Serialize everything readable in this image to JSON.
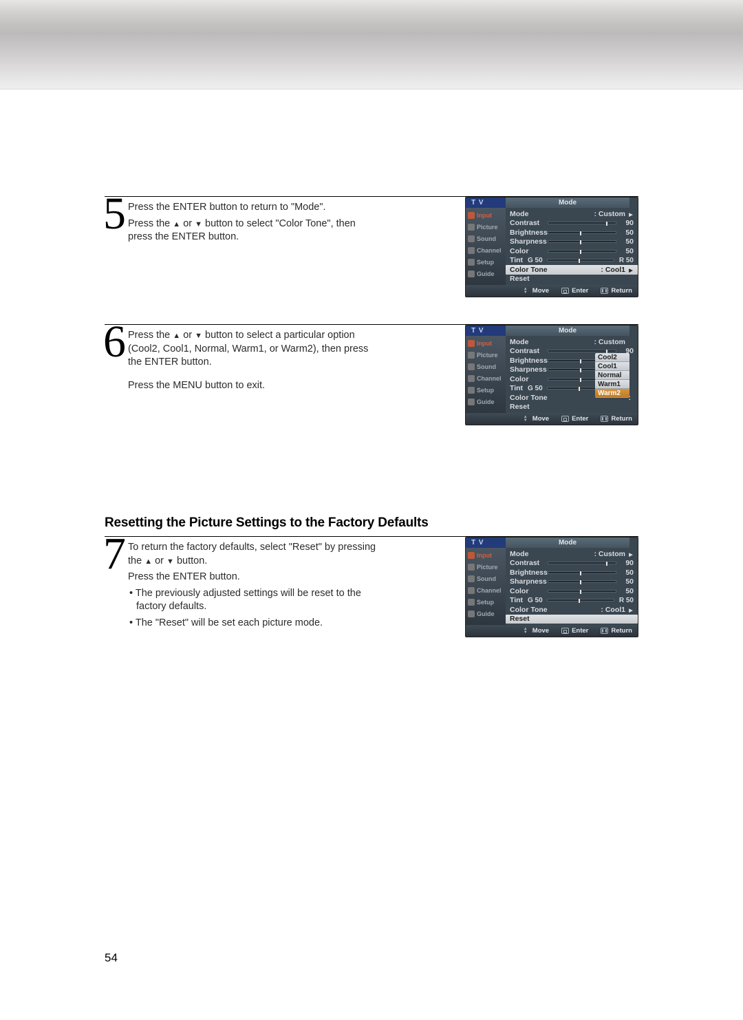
{
  "page_number": "54",
  "steps": {
    "s5": {
      "num": "5",
      "line1_a": "Press the ENTER button to return to \"Mode\".",
      "line2_a": "Press the ",
      "line2_b": " or ",
      "line2_c": " button to select \"Color Tone\", then press the ENTER button."
    },
    "s6": {
      "num": "6",
      "line1_a": "Press the ",
      "line1_b": " or ",
      "line1_c": " button to select a particular option (Cool2, Cool1, Normal, Warm1, or Warm2), then press the ENTER button.",
      "line2": "Press the MENU button to exit."
    },
    "s7": {
      "num": "7",
      "line1_a": "To return the factory defaults, select \"Reset\" by pressing the ",
      "line1_b": " or ",
      "line1_c": " button.",
      "line2": "Press the ENTER button.",
      "bul1": "• The previously adjusted settings will be reset to the factory defaults.",
      "bul2": "• The \"Reset\" will be set each picture mode."
    }
  },
  "section_heading": "Resetting the Picture Settings to the Factory Defaults",
  "osd_common": {
    "tv": "T V",
    "title": "Mode",
    "sidebar": [
      "Input",
      "Picture",
      "Sound",
      "Channel",
      "Setup",
      "Guide"
    ],
    "foot": {
      "move": "Move",
      "enter": "Enter",
      "return": "Return"
    }
  },
  "osd1": {
    "rows": {
      "mode": {
        "label": "Mode",
        "value": "Custom",
        "caret": true
      },
      "contrast": {
        "label": "Contrast",
        "value": "90",
        "pct": 87
      },
      "brightness": {
        "label": "Brightness",
        "value": "50",
        "pct": 48
      },
      "sharpness": {
        "label": "Sharpness",
        "value": "50",
        "pct": 48
      },
      "color": {
        "label": "Color",
        "value": "50",
        "pct": 48
      },
      "tint": {
        "label": "Tint",
        "g": "G 50",
        "r": "R 50",
        "pct": 48
      },
      "colortone": {
        "label": "Color Tone",
        "value": "Cool1",
        "caret": true,
        "hl": true
      },
      "reset": {
        "label": "Reset"
      }
    }
  },
  "osd2": {
    "rows": {
      "mode": {
        "label": "Mode",
        "value": "Custom"
      },
      "contrast": {
        "label": "Contrast",
        "value": "90",
        "pct": 87
      },
      "brightness": {
        "label": "Brightness",
        "pct": 48
      },
      "sharpness": {
        "label": "Sharpness",
        "pct": 48
      },
      "color": {
        "label": "Color",
        "pct": 48
      },
      "tint": {
        "label": "Tint",
        "g": "G 50",
        "pct": 48
      },
      "colortone": {
        "label": "Color Tone"
      },
      "reset": {
        "label": "Reset"
      }
    },
    "tone_list": [
      "Cool2",
      "Cool1",
      "Normal",
      "Warm1",
      "Warm2"
    ],
    "tone_selected": "Warm2"
  },
  "osd3": {
    "rows": {
      "mode": {
        "label": "Mode",
        "value": "Custom",
        "caret": true
      },
      "contrast": {
        "label": "Contrast",
        "value": "90",
        "pct": 87
      },
      "brightness": {
        "label": "Brightness",
        "value": "50",
        "pct": 48
      },
      "sharpness": {
        "label": "Sharpness",
        "value": "50",
        "pct": 48
      },
      "color": {
        "label": "Color",
        "value": "50",
        "pct": 48
      },
      "tint": {
        "label": "Tint",
        "g": "G 50",
        "r": "R 50",
        "pct": 48
      },
      "colortone": {
        "label": "Color Tone",
        "value": "Cool1",
        "caret": true
      },
      "reset": {
        "label": "Reset",
        "hl": true
      }
    }
  }
}
